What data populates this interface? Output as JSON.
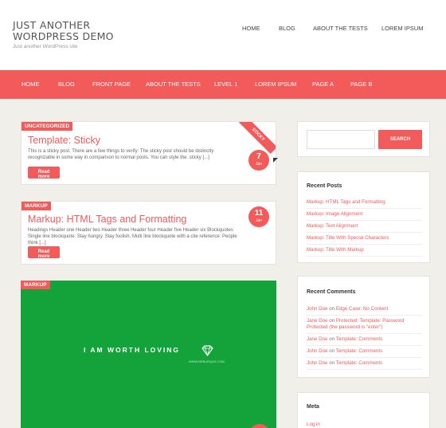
{
  "site": {
    "title": "JUST ANOTHER WORDPRESS DEMO",
    "description": "Just another WordPress site"
  },
  "top_nav": [
    "HOME",
    "BLOG",
    "ABOUT THE TESTS",
    "LOREM IPSUM"
  ],
  "main_nav": [
    "HOME",
    "BLOG",
    "FRONT PAGE",
    "ABOUT THE TESTS",
    "LEVEL 1",
    "LOREM IPSUM",
    "PAGE A",
    "PAGE B"
  ],
  "posts": [
    {
      "category": "UNCATEGORIZED",
      "title": "Template: Sticky",
      "excerpt": "This is a sticky post. There are a few things to verify: The sticky post should be distinctly recognizable in some way in comparison to normal posts. You can style the .sticky [...]",
      "read_more": "Read more",
      "day": "7",
      "month": "Jan",
      "ribbon": "STICKY"
    },
    {
      "category": "MARKUP",
      "title": "Markup: HTML Tags and Formatting",
      "excerpt": "Headings Header one Header two Header three Header four Header five Header six Blockquotes Single line blockquote: Stay hungry. Stay foolish. Multi line blockquote with a cite reference: People think [...]",
      "read_more": "Read more",
      "day": "11",
      "month": "Jan"
    },
    {
      "category": "MARKUP",
      "feature_text": "I AM WORTH LOVING",
      "feature_sub": "WWW.BEBURQAS.COM"
    }
  ],
  "search": {
    "placeholder": "",
    "button": "SEARCH"
  },
  "recent_posts": {
    "heading": "Recent Posts",
    "items": [
      "Markup: HTML Tags and Formatting",
      "Markup: Image Alignment",
      "Markup: Text Alignment",
      "Markup: Title With Special Characters",
      "Markup: Title With Markup"
    ]
  },
  "recent_comments": {
    "heading": "Recent Comments",
    "on": "on",
    "items": [
      {
        "author": "John Doe",
        "post": "Edge Case: No Content"
      },
      {
        "author": "Jane Doe",
        "post": "Protected: Template: Password Protected (the password is \"enter\")"
      },
      {
        "author": "Jane Doe",
        "post": "Template: Comments"
      },
      {
        "author": "John Doe",
        "post": "Template: Comments"
      },
      {
        "author": "John Doe",
        "post": "Template: Comments"
      }
    ]
  },
  "meta": {
    "heading": "Meta",
    "items": [
      "Log in"
    ]
  },
  "colors": {
    "accent": "#f35a5a",
    "feature_bg": "#14a33a",
    "page_bg": "#f1efea"
  },
  "icons": {
    "feature_logo": "diamond-heart-icon"
  }
}
